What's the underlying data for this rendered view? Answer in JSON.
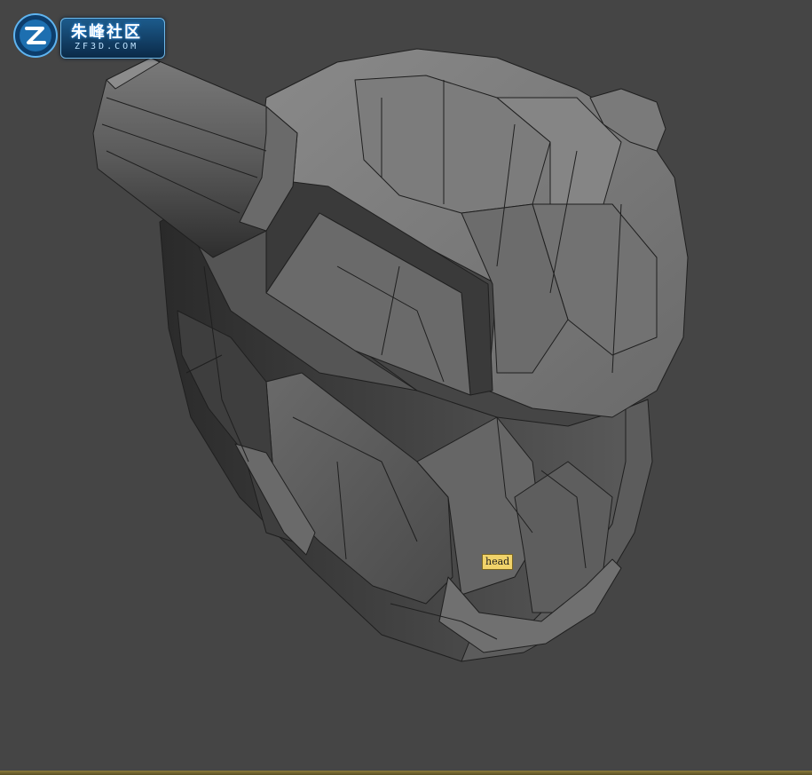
{
  "logo": {
    "title": "朱峰社区",
    "subtitle": "ZF3D.COM",
    "icon": "zf-logo-icon"
  },
  "viewport": {
    "object_label": "head",
    "border_color": "#8a7a3a",
    "background_color": "#454545"
  }
}
